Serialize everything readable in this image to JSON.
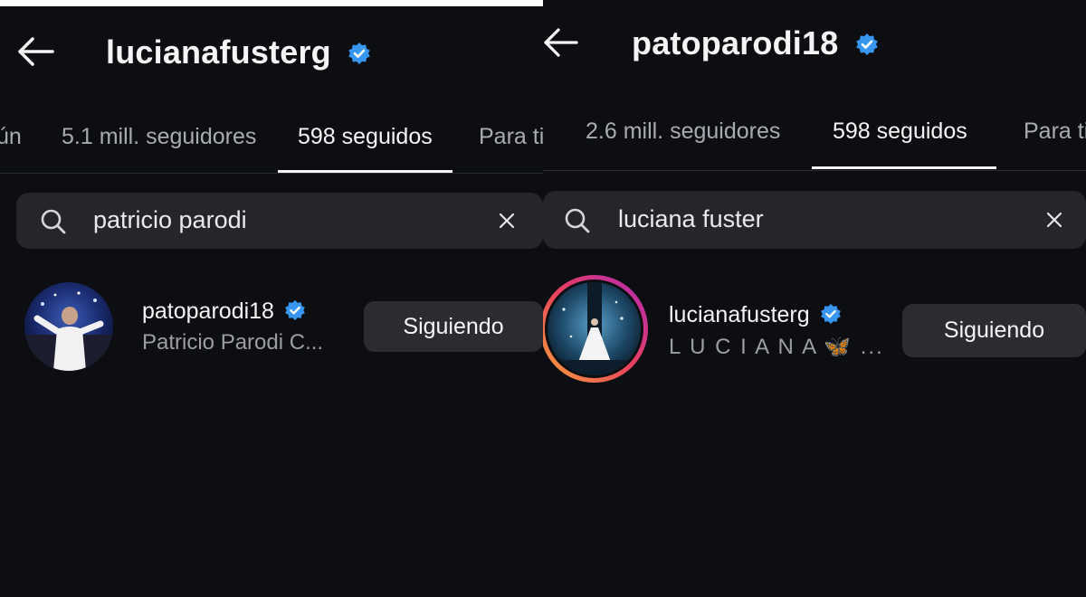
{
  "left": {
    "header": {
      "username": "lucianafusterg"
    },
    "tabs": [
      {
        "label": "ún"
      },
      {
        "label": "5.1 mill. seguidores"
      },
      {
        "label": "598 seguidos",
        "active": true
      },
      {
        "label": "Para ti"
      }
    ],
    "search": {
      "value": "patricio parodi"
    },
    "result": {
      "username": "patoparodi18",
      "subtitle": "Patricio Parodi C...",
      "button_label": "Siguiendo"
    }
  },
  "right": {
    "header": {
      "username": "patoparodi18"
    },
    "tabs": [
      {
        "label": "2.6 mill. seguidores"
      },
      {
        "label": "598 seguidos",
        "active": true
      },
      {
        "label": "Para ti"
      }
    ],
    "search": {
      "value": "luciana fuster"
    },
    "result": {
      "username": "lucianafusterg",
      "subtitle": "L U C I A N A",
      "subtitle_emoji": "🦋",
      "subtitle_suffix": " ...",
      "button_label": "Siguiendo"
    }
  },
  "colors": {
    "background": "#0d0e12",
    "verified_badge": "#3797f0",
    "search_bg": "#24262c",
    "button_bg": "#2a2c32",
    "muted_text": "#a9abb2",
    "story_ring_start": "#f9a23b",
    "story_ring_end": "#d3217b"
  },
  "icons": [
    "back-arrow-icon",
    "verified-badge-icon",
    "search-icon",
    "clear-icon"
  ]
}
